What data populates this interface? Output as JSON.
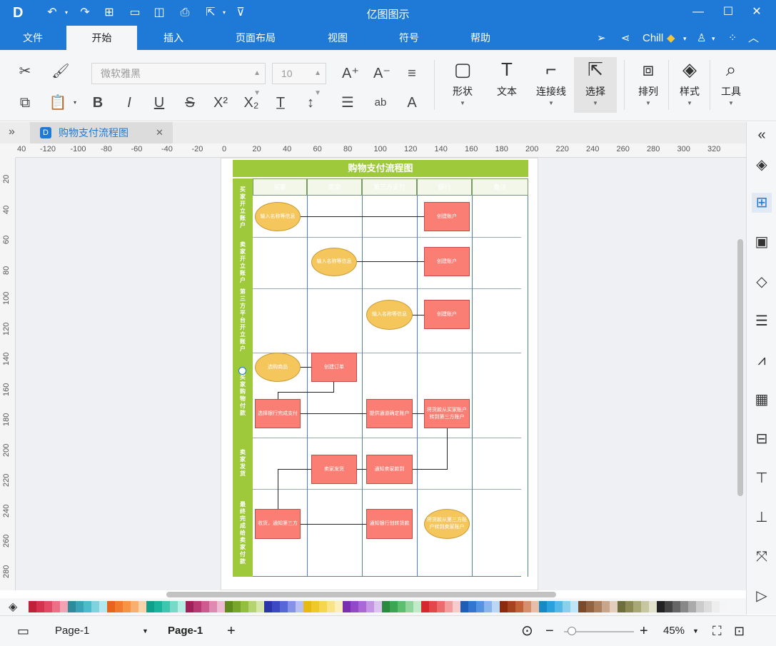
{
  "titlebar": {
    "title": "亿图图示",
    "logo": "D"
  },
  "menu": {
    "items": [
      "文件",
      "开始",
      "插入",
      "页面布局",
      "视图",
      "符号",
      "帮助"
    ],
    "active": "开始",
    "user": "Chill"
  },
  "ribbon": {
    "font_name": "微软雅黑",
    "font_size": "10",
    "big_buttons": [
      "形状",
      "文本",
      "连接线",
      "选择",
      "排列",
      "样式",
      "工具"
    ]
  },
  "tab": {
    "title": "购物支付流程图"
  },
  "ruler": {
    "h": [
      "40",
      "-120",
      "-100",
      "-80",
      "-60",
      "-40",
      "-20",
      "0",
      "20",
      "40",
      "60",
      "80",
      "100",
      "120",
      "140",
      "160",
      "180",
      "200",
      "220",
      "240",
      "260",
      "280",
      "300",
      "320"
    ],
    "v": [
      "20",
      "40",
      "60",
      "80",
      "100",
      "120",
      "140",
      "160",
      "180",
      "200",
      "220",
      "240",
      "260",
      "280"
    ]
  },
  "diagram": {
    "title": "购物支付流程图",
    "columns": [
      "买家",
      "卖家",
      "第三方支付",
      "银行",
      "备注"
    ],
    "lanes": [
      "买家开立账户",
      "卖家开立账户",
      "第三方平台开立账户",
      "买家购物付款",
      "卖家发货",
      "最终完成给卖家付款"
    ],
    "shapes": {
      "s1": "输入名称等信息",
      "s2": "创建账户",
      "s3": "输入名称等信息",
      "s4": "创建账户",
      "s5": "输入名称等信息",
      "s6": "创建账户",
      "s7": "选购商品",
      "s8": "创建订单",
      "s9": "选择银行完成支付",
      "s10": "提供通道确定账户",
      "s11": "将货款从买家账户转到第三方账户",
      "s12": "卖家发货",
      "s13": "通知卖家款到",
      "s14": "收货，通知第三方",
      "s15": "通知银行划转货款",
      "s16": "将货款从第三方账户转到卖家账户"
    }
  },
  "colors": {
    "accent": "#1e7ad6",
    "lane": "#9dc93b",
    "rect": "#fa7e73",
    "oval": "#f4c65c"
  },
  "palette": [
    "#c0203a",
    "#d6324d",
    "#e04a64",
    "#ea6f87",
    "#f1a3b4",
    "#2e8b9a",
    "#3aa3b5",
    "#4cbccc",
    "#7fd3df",
    "#b4e8ef",
    "#e8641b",
    "#f07a2e",
    "#f59445",
    "#f8b072",
    "#fcd2ab",
    "#0f9f8a",
    "#1bb39c",
    "#3ec6af",
    "#79d9c8",
    "#b5ece3",
    "#a0205a",
    "#b83a74",
    "#cd5b90",
    "#de8ab1",
    "#edbbd2",
    "#5e8a1e",
    "#78a52b",
    "#94be3f",
    "#b5d36f",
    "#d5e6a7",
    "#2a35a8",
    "#3c49c3",
    "#5767d8",
    "#8592e6",
    "#b8c0f2",
    "#e8b90f",
    "#f0c928",
    "#f5d74f",
    "#f8e386",
    "#fbefba",
    "#7b2fb0",
    "#9447c7",
    "#ab67d6",
    "#c495e4",
    "#dcc3f0",
    "#2a8a3e",
    "#3aa552",
    "#5cbf70",
    "#8ed69c",
    "#c0eac8",
    "#d6282b",
    "#e4474a",
    "#ec6c6e",
    "#f39c9d",
    "#f8cacb",
    "#1f5eb8",
    "#3376cf",
    "#5493e0",
    "#88b6ec",
    "#bcd6f6",
    "#8b2b0e",
    "#a6431f",
    "#c06235",
    "#d68f6a",
    "#e9bea6",
    "#1689c7",
    "#2aa1dc",
    "#54b8e7",
    "#8bcfef",
    "#c0e5f7",
    "#7a4a2a",
    "#93623f",
    "#ad7f5b",
    "#c9a58a",
    "#e3cdbd",
    "#6e6e3a",
    "#8a8a52",
    "#a8a874",
    "#c6c6a0",
    "#e2e2cc",
    "#222222",
    "#444444",
    "#666666",
    "#888888",
    "#aaaaaa",
    "#cccccc",
    "#dddddd",
    "#eeeeee",
    "#f5f5f5"
  ],
  "status": {
    "page_select": "Page-1",
    "page_tab": "Page-1",
    "zoom": "45%"
  }
}
